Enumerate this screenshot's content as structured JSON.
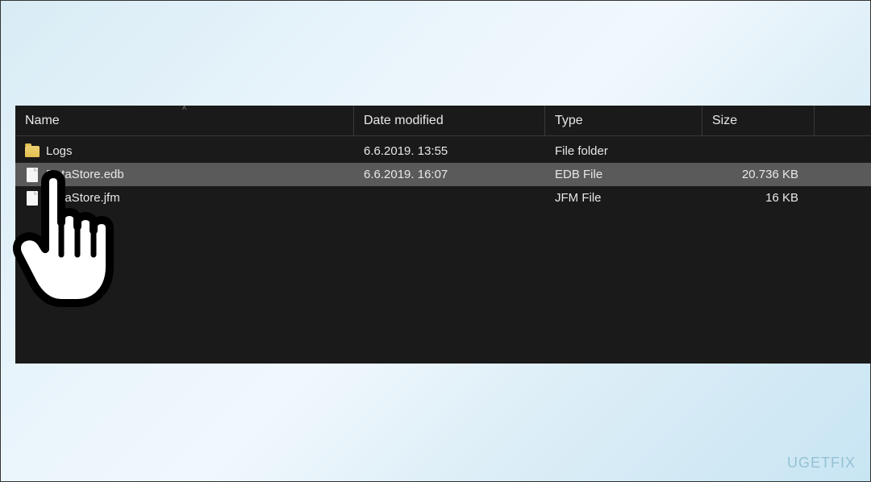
{
  "columns": {
    "name": "Name",
    "date": "Date modified",
    "type": "Type",
    "size": "Size"
  },
  "files": [
    {
      "name": "Logs",
      "date": "6.6.2019. 13:55",
      "type": "File folder",
      "size": "",
      "icon": "folder",
      "selected": false
    },
    {
      "name": "DataStore.edb",
      "date": "6.6.2019. 16:07",
      "type": "EDB File",
      "size": "20.736 KB",
      "icon": "file",
      "selected": true
    },
    {
      "name": "DataStore.jfm",
      "date": "",
      "type": "JFM File",
      "size": "16 KB",
      "icon": "file",
      "selected": false
    }
  ],
  "watermark": "UGETFIX"
}
